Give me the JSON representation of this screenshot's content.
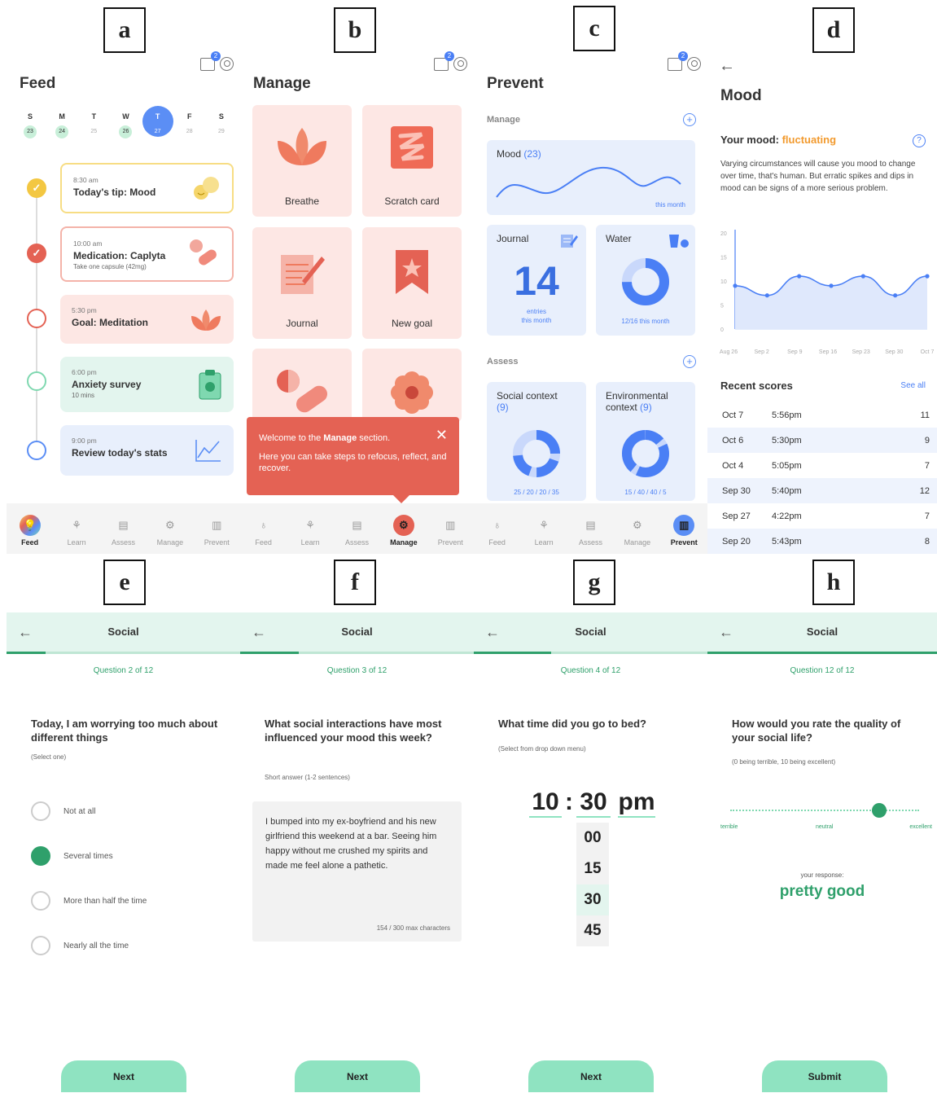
{
  "labels": {
    "a": "a",
    "b": "b",
    "c": "c",
    "d": "d",
    "e": "e",
    "f": "f",
    "g": "g",
    "h": "h"
  },
  "badge": "2",
  "nav": {
    "feed": "Feed",
    "learn": "Learn",
    "assess": "Assess",
    "manage": "Manage",
    "prevent": "Prevent"
  },
  "feed": {
    "title": "Feed",
    "days": [
      {
        "l": "S",
        "n": "23"
      },
      {
        "l": "M",
        "n": "24"
      },
      {
        "l": "T",
        "n": "25"
      },
      {
        "l": "W",
        "n": "26"
      },
      {
        "l": "T",
        "n": "27"
      },
      {
        "l": "F",
        "n": "28"
      },
      {
        "l": "S",
        "n": "29"
      }
    ],
    "cards": [
      {
        "time": "8:30 am",
        "title": "Today's tip: Mood",
        "sub": ""
      },
      {
        "time": "10:00 am",
        "title": "Medication: Caplyta",
        "sub": "Take one capsule (42mg)"
      },
      {
        "time": "5:30 pm",
        "title": "Goal: Meditation",
        "sub": ""
      },
      {
        "time": "6:00 pm",
        "title": "Anxiety survey",
        "sub": "10 mins"
      },
      {
        "time": "9:00 pm",
        "title": "Review today's stats",
        "sub": ""
      }
    ]
  },
  "manage": {
    "title": "Manage",
    "tiles": [
      "Breathe",
      "Scratch card",
      "Journal",
      "New goal"
    ],
    "tooltip": {
      "line1_pre": "Welcome to the ",
      "line1_bold": "Manage",
      "line1_post": " section.",
      "line2": "Here you can take steps to refocus, reflect, and recover.",
      "close": "✕"
    }
  },
  "prevent": {
    "title": "Prevent",
    "manage_section": "Manage",
    "assess_section": "Assess",
    "mood": {
      "label": "Mood",
      "count": "(23)",
      "period": "this month"
    },
    "journal": {
      "label": "Journal",
      "value": "14",
      "sub1": "entries",
      "sub2": "this month"
    },
    "water": {
      "label": "Water",
      "sub": "12/16 this month"
    },
    "social": {
      "label": "Social context",
      "count": "(9)",
      "values": "25 / 20 / 20 / 35"
    },
    "env": {
      "label1": "Environmental",
      "label2": "context",
      "count": "(9)",
      "values": "15 / 40 / 40 / 5"
    }
  },
  "mood": {
    "title": "Mood",
    "your_mood": "Your mood: ",
    "state": "fluctuating",
    "desc": "Varying circumstances will cause you mood to change over time, that's human. But erratic spikes and dips in mood can be signs of a more serious problem.",
    "recent": "Recent scores",
    "see_all": "See all",
    "yticks": [
      "20",
      "15",
      "10",
      "5",
      "0"
    ],
    "xticks": [
      "Aug 26",
      "Sep 2",
      "Sep 9",
      "Sep 16",
      "Sep 23",
      "Sep 30",
      "Oct 7"
    ],
    "scores": [
      {
        "d": "Oct 7",
        "t": "5:56pm",
        "v": "11"
      },
      {
        "d": "Oct 6",
        "t": "5:30pm",
        "v": "9"
      },
      {
        "d": "Oct 4",
        "t": "5:05pm",
        "v": "7"
      },
      {
        "d": "Sep 30",
        "t": "5:40pm",
        "v": "12"
      },
      {
        "d": "Sep 27",
        "t": "4:22pm",
        "v": "7"
      },
      {
        "d": "Sep 20",
        "t": "5:43pm",
        "v": "8"
      }
    ]
  },
  "chart_data": {
    "type": "area",
    "x": [
      "Aug 26",
      "Sep 2",
      "Sep 9",
      "Sep 16",
      "Sep 23",
      "Sep 30",
      "Oct 7"
    ],
    "values": [
      9,
      7,
      11,
      9,
      11,
      7,
      11
    ],
    "ylim": [
      0,
      20
    ]
  },
  "q": {
    "header": "Social",
    "e": {
      "num": "Question 2 of 12",
      "text": "Today, I am worrying too much about different things",
      "hint": "(Select one)",
      "options": [
        "Not at all",
        "Several times",
        "More than half the time",
        "Nearly all the time"
      ],
      "btn": "Next"
    },
    "f": {
      "num": "Question 3 of 12",
      "text": "What social interactions have most influenced your mood this week?",
      "hint": "Short answer (1-2 sentences)",
      "answer": "I bumped into my ex-boyfriend and his new girlfriend this weekend at a bar. Seeing him happy without me crushed my spirits and made me feel alone a pathetic.",
      "count": "154 / 300 max characters",
      "btn": "Next"
    },
    "g": {
      "num": "Question 4 of 12",
      "text": "What time did you go to bed?",
      "hint": "(Select from drop down menu)",
      "hour": "10",
      "colon": ":",
      "min": "30",
      "ampm": "pm",
      "opts": [
        "00",
        "15",
        "30",
        "45"
      ],
      "btn": "Next"
    },
    "h": {
      "num": "Question 12 of 12",
      "text": "How would you rate the quality of your social life?",
      "hint": "(0 being terrible, 10 being excellent)",
      "l": "terrible",
      "m": "neutral",
      "r": "excellent",
      "resp_label": "your response:",
      "resp": "pretty good",
      "btn": "Submit"
    }
  },
  "colors": {
    "green": "#2fa06b",
    "coral": "#e46254",
    "blue": "#4a7ff5"
  }
}
